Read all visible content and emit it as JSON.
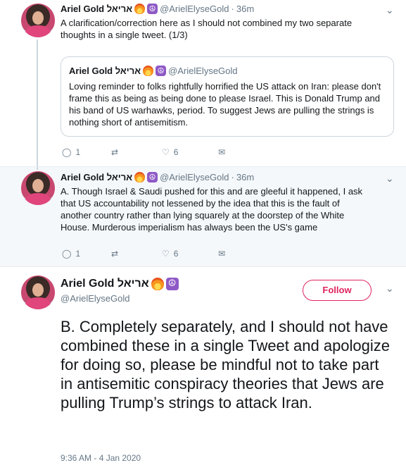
{
  "tweets": [
    {
      "name": "Ariel Gold אריאל",
      "handle": "@ArielElyseGold",
      "sep": "·",
      "age": "36m",
      "text": "A clarification/correction here as I should not combined my two separate thoughts in a single tweet. (1/3)",
      "quote": {
        "name": "Ariel Gold אריאל",
        "handle": "@ArielElyseGold",
        "text": "Loving reminder to folks rightfully horrified the US attack on Iran: please don't frame this as being as being done to please Israel. This is Donald Trump and his band of US warhawks, period. To suggest Jews are pulling the strings is nothing short of antisemitism."
      },
      "replies": "1",
      "likes": "6"
    },
    {
      "name": "Ariel Gold אריאל",
      "handle": "@ArielElyseGold",
      "sep": "·",
      "age": "36m",
      "text": "A. Though Israel & Saudi pushed for this and are gleeful it happened, I ask that US accountability not lessened by the idea that this is the fault of another country rather than lying squarely at the doorstep of the White House. Murderous imperialism has always been the US's game",
      "replies": "1",
      "likes": "6"
    }
  ],
  "main": {
    "name": "Ariel Gold אריאל",
    "handle": "@ArielElyseGold",
    "follow_label": "Follow",
    "text": "B. Completely separately, and I should not have combined these in a single Tweet and apologize for doing so, please be mindful not to take part in antisemitic conspiracy theories that Jews are pulling Trump’s strings to attack Iran.",
    "timestamp": "9:36 AM - 4 Jan 2020"
  },
  "icons": {
    "fire": "fire-emoji-icon",
    "peace": "peace-symbol-icon",
    "reply": "reply-icon",
    "retweet": "retweet-icon",
    "like": "heart-icon",
    "message": "direct-message-icon",
    "caret": "chevron-down-icon"
  },
  "colors": {
    "follow": "#e0245e",
    "secondary_text": "#657786",
    "thread_line": "#ccd6dd",
    "highlight_bg": "#f5f8fa"
  }
}
